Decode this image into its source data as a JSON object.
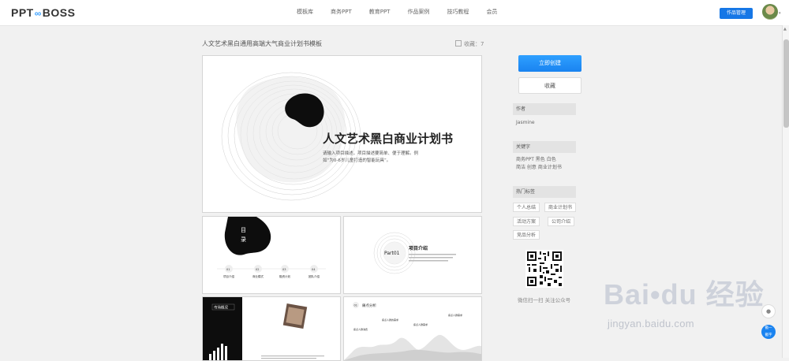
{
  "header": {
    "logo_left": "PPT",
    "logo_mid": "∞",
    "logo_right": "BOSS",
    "nav": [
      "模板库",
      "商务PPT",
      "教育PPT",
      "作品案例",
      "技巧教程",
      "会员"
    ],
    "my_works": "作品管理"
  },
  "main": {
    "title": "人文艺术黑白通用高端大气商业计划书模板",
    "fav_label": "收藏：7",
    "slide1": {
      "heading": "人文艺术黑白商业计划书",
      "line1": "请输入项目描述，项目描述要简单、便于理解。例",
      "line2": "如“为0-6岁儿童打造的智能玩具”。"
    },
    "slide2": {
      "title_a": "目",
      "title_b": "录",
      "items": [
        {
          "num": "01",
          "label": "项目介绍"
        },
        {
          "num": "02",
          "label": "商业模式"
        },
        {
          "num": "03",
          "label": "融资计划"
        },
        {
          "num": "04",
          "label": "团队介绍"
        }
      ]
    },
    "slide3": {
      "part": "Part01",
      "title": "项目介绍"
    },
    "slide4": {
      "label": "市场概况"
    },
    "slide5": {
      "num": "01",
      "title": "痛点分析",
      "items": [
        "痛点人群的需求",
        "痛点人群消费",
        "痛点人群需求",
        "痛点人群需求"
      ]
    }
  },
  "sidebar": {
    "create_btn": "立即创建",
    "collect_btn": "收藏",
    "author_head": "作者",
    "author": "Jasmine",
    "keywords_head": "关键字",
    "keywords_line1": "商务PPT  黑色  白色",
    "keywords_line2": "简洁  创意  商业计划书",
    "hot_head": "热门标签",
    "tags": [
      "个人总结",
      "商业计划书",
      "活动方案",
      "公司介绍",
      "竞品分析"
    ],
    "qr_caption": "微信扫一扫 关注公众号"
  },
  "watermark": {
    "logo": "Bai•du 经验",
    "url": "jingyan.baidu.com"
  },
  "float": {
    "btn2_a": "戳一",
    "btn2_b": "戳字"
  },
  "colors": {
    "accent": "#1a83f0",
    "watermark": "#c8cdd7"
  }
}
